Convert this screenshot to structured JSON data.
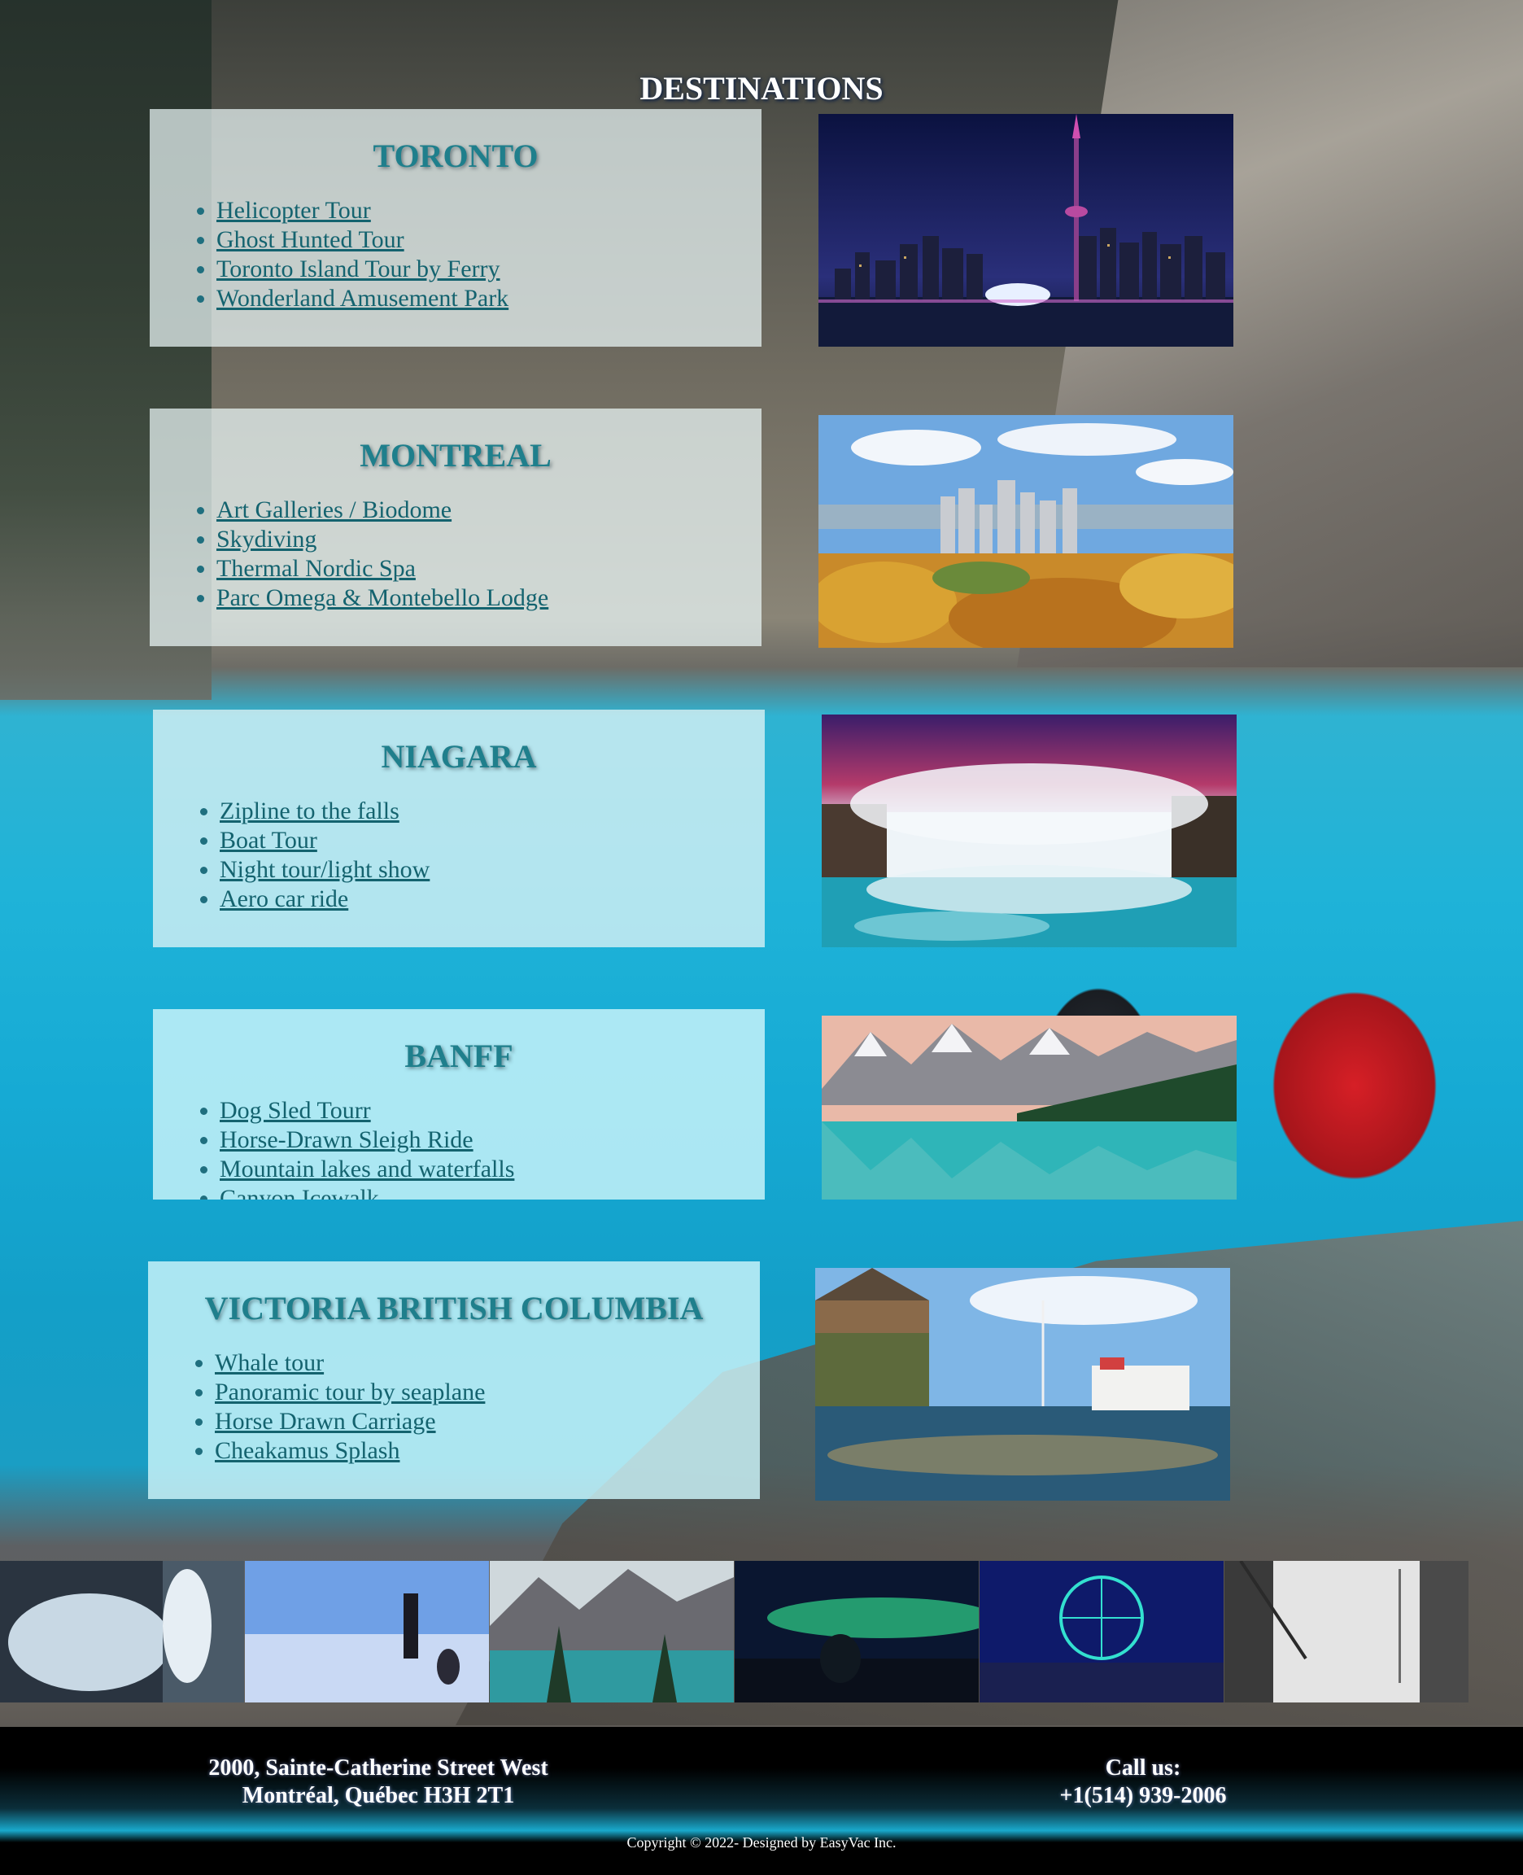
{
  "header": {
    "title": "DESTINATIONS"
  },
  "destinations": [
    {
      "name": "TORONTO",
      "activities": [
        "Helicopter Tour",
        "Ghost Hunted Tour",
        "Toronto Island Tour by Ferry",
        "Wonderland Amusement Park"
      ],
      "photo": "toronto-skyline-night"
    },
    {
      "name": "MONTREAL",
      "activities": [
        "Art Galleries / Biodome",
        "Skydiving",
        "Thermal Nordic Spa",
        "Parc Omega & Montebello Lodge"
      ],
      "photo": "montreal-autumn-skyline"
    },
    {
      "name": "NIAGARA",
      "activities": [
        "Zipline to the falls",
        "Boat Tour",
        "Night tour/light show",
        "Aero car ride"
      ],
      "photo": "niagara-falls"
    },
    {
      "name": "BANFF",
      "activities": [
        "Dog Sled Tourr",
        "Horse-Drawn Sleigh Ride",
        "Mountain lakes and waterfalls",
        "Canyon Icewalk"
      ],
      "photo": "banff-mountain-lake"
    },
    {
      "name": "VICTORIA BRITISH COLUMBIA",
      "activities": [
        "Whale tour",
        "Panoramic tour by seaplane",
        "Horse Drawn Carriage",
        "Cheakamus Splash"
      ],
      "photo": "victoria-harbour"
    }
  ],
  "gallery": [
    "frozen-waterfall",
    "snow-kiting",
    "mountain-lake",
    "northern-lights",
    "ferris-wheel-night",
    "cn-tower-street"
  ],
  "footer": {
    "address_line1": "2000, Sainte-Catherine Street West",
    "address_line2": "Montréal, Québec H3H 2T1",
    "call_label": "Call us:",
    "phone": "+1(514) 939-2006",
    "copyright": "Copyright © 2022- Designed by EasyVac Inc."
  },
  "colors": {
    "heading_teal": "#1f7f8c",
    "link_teal": "#14636f",
    "water": "#16aad4"
  }
}
